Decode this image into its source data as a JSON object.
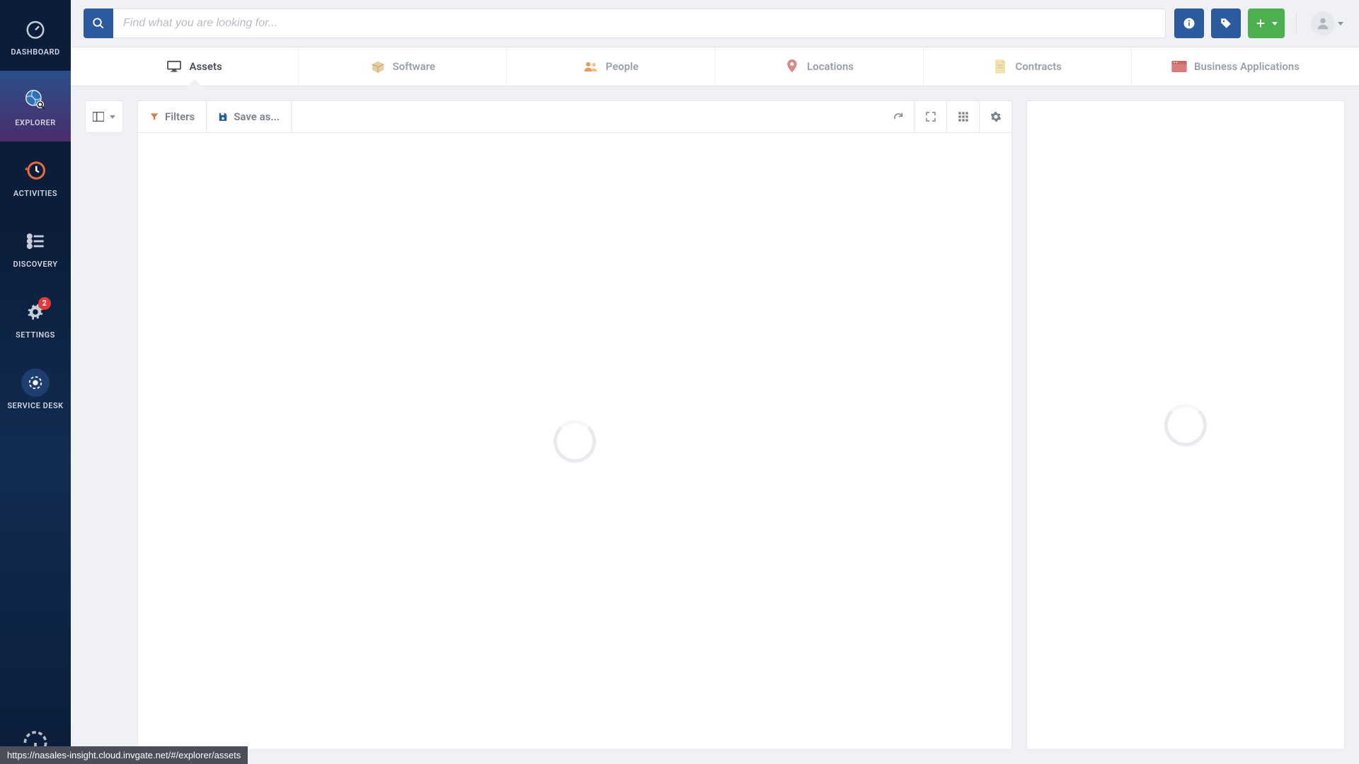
{
  "sidebar": {
    "items": [
      {
        "label": "DASHBOARD"
      },
      {
        "label": "EXPLORER"
      },
      {
        "label": "ACTIVITIES"
      },
      {
        "label": "DISCOVERY"
      },
      {
        "label": "SETTINGS",
        "badge": "2"
      },
      {
        "label": "SERVICE DESK"
      }
    ]
  },
  "search": {
    "placeholder": "Find what you are looking for..."
  },
  "category_tabs": [
    {
      "label": "Assets"
    },
    {
      "label": "Software"
    },
    {
      "label": "People"
    },
    {
      "label": "Locations"
    },
    {
      "label": "Contracts"
    },
    {
      "label": "Business Applications"
    }
  ],
  "toolbar": {
    "filters_label": "Filters",
    "save_as_label": "Save as..."
  },
  "status_tooltip": "https://nasales-insight.cloud.invgate.net/#/explorer/assets"
}
